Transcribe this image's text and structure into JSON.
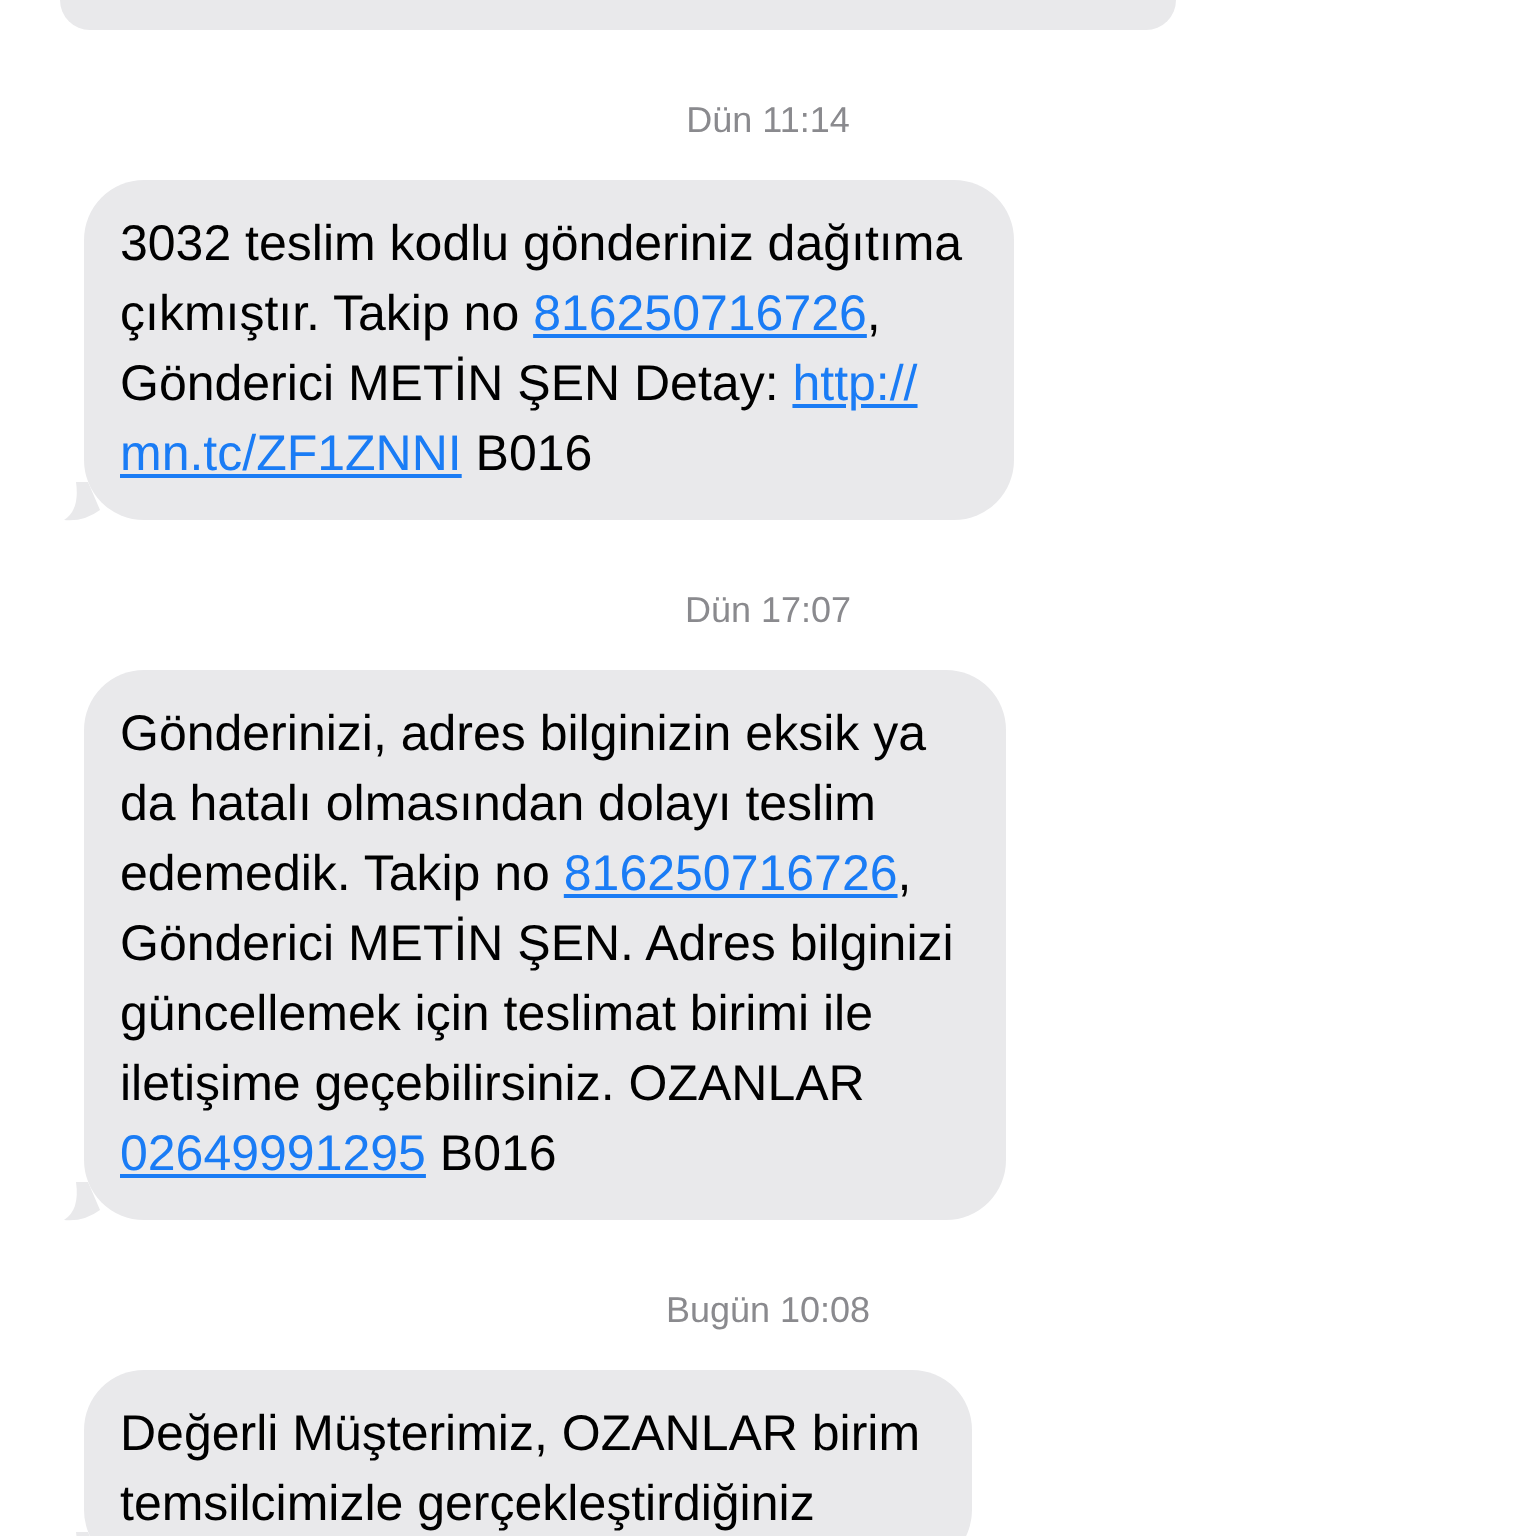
{
  "messages": [
    {
      "timestamp": "Dün 11:14",
      "lines": [
        [
          {
            "kind": "text",
            "text": "3032 teslim kodlu gönderiniz dağıtıma"
          }
        ],
        [
          {
            "kind": "text",
            "text": "çıkmıştır. Takip no "
          },
          {
            "kind": "link",
            "text": "816250716726"
          },
          {
            "kind": "text",
            "text": ","
          }
        ],
        [
          {
            "kind": "text",
            "text": "Gönderici METİN ŞEN Detay: "
          },
          {
            "kind": "link",
            "text": "http://"
          }
        ],
        [
          {
            "kind": "link",
            "text": "mn.tc/ZF1ZNNI"
          },
          {
            "kind": "text",
            "text": " B016"
          }
        ]
      ]
    },
    {
      "timestamp": "Dün 17:07",
      "lines": [
        [
          {
            "kind": "text",
            "text": "Gönderinizi, adres bilginizin eksik ya"
          }
        ],
        [
          {
            "kind": "text",
            "text": "da hatalı olmasından dolayı teslim"
          }
        ],
        [
          {
            "kind": "text",
            "text": "edemedik. Takip no "
          },
          {
            "kind": "link",
            "text": "816250716726"
          },
          {
            "kind": "text",
            "text": ","
          }
        ],
        [
          {
            "kind": "text",
            "text": "Gönderici METİN ŞEN. Adres bilginizi"
          }
        ],
        [
          {
            "kind": "text",
            "text": "güncellemek için teslimat birimi ile"
          }
        ],
        [
          {
            "kind": "text",
            "text": "iletişime geçebilirsiniz. OZANLAR"
          }
        ],
        [
          {
            "kind": "link",
            "text": "02649991295"
          },
          {
            "kind": "text",
            "text": " B016"
          }
        ]
      ]
    },
    {
      "timestamp": "Bugün 10:08",
      "lines": [
        [
          {
            "kind": "text",
            "text": "Değerli Müşterimiz, OZANLAR birim"
          }
        ],
        [
          {
            "kind": "text",
            "text": "temsilcimizle gerçekleştirdiğiniz"
          }
        ]
      ]
    }
  ]
}
